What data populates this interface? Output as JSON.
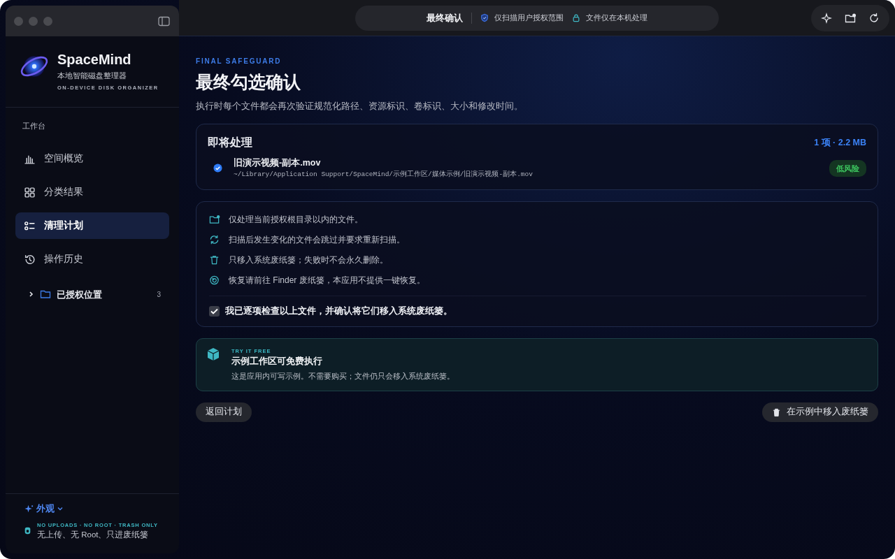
{
  "window": {
    "title": "最终确认",
    "badges": [
      {
        "kind": "shield",
        "text": "仅扫描用户授权范围"
      },
      {
        "kind": "lock",
        "text": "文件仅在本机处理"
      }
    ],
    "tools": [
      {
        "kind": "sparkle"
      },
      {
        "kind": "folder-add"
      },
      {
        "kind": "refresh"
      }
    ]
  },
  "sidebar": {
    "app_name": "SpaceMind",
    "app_subtitle": "本地智能磁盘整理器",
    "app_tagline": "ON-DEVICE DISK ORGANIZER",
    "section": "工作台",
    "items": [
      {
        "kind": "chart",
        "label": "空间概览",
        "selected": false
      },
      {
        "kind": "grid",
        "label": "分类结果",
        "selected": false
      },
      {
        "kind": "list",
        "label": "清理计划",
        "selected": true
      },
      {
        "kind": "history",
        "label": "操作历史",
        "selected": false
      }
    ],
    "locations": {
      "label": "已授权位置",
      "count": "3",
      "expanded": false
    },
    "appearance": "外观",
    "privacy_tag": "NO UPLOADS · NO ROOT · TRASH ONLY",
    "privacy_text": "无上传、无 Root、只进废纸篓"
  },
  "page": {
    "eyebrow": "FINAL SAFEGUARD",
    "title": "最终勾选确认",
    "subtitle": "执行时每个文件都会再次验证规范化路径、资源标识、卷标识、大小和修改时间。"
  },
  "pending": {
    "title": "即将处理",
    "summary": "1 项 · 2.2 MB",
    "files": [
      {
        "name": "旧演示视频-副本.mov",
        "path": "~/Library/Application Support/SpaceMind/示例工作区/媒体示例/旧演示视频-副本.mov",
        "risk": "低风险",
        "checked": true
      }
    ]
  },
  "rules": [
    {
      "kind": "folder",
      "text": "仅处理当前授权根目录以内的文件。"
    },
    {
      "kind": "refresh",
      "text": "扫描后发生变化的文件会跳过并要求重新扫描。"
    },
    {
      "kind": "trash",
      "text": "只移入系统废纸篓；失败时不会永久删除。"
    },
    {
      "kind": "restore",
      "text": "恢复请前往 Finder 废纸篓，本应用不提供一键恢复。"
    }
  ],
  "confirm": {
    "label": "我已逐项检查以上文件，并确认将它们移入系统废纸篓。",
    "checked": true
  },
  "trial": {
    "eyebrow": "TRY IT FREE",
    "title": "示例工作区可免费执行",
    "text": "这是应用内可写示例。不需要购买；文件仍只会移入系统废纸篓。"
  },
  "buttons": {
    "back": "返回计划",
    "execute": "在示例中移入废纸篓"
  }
}
